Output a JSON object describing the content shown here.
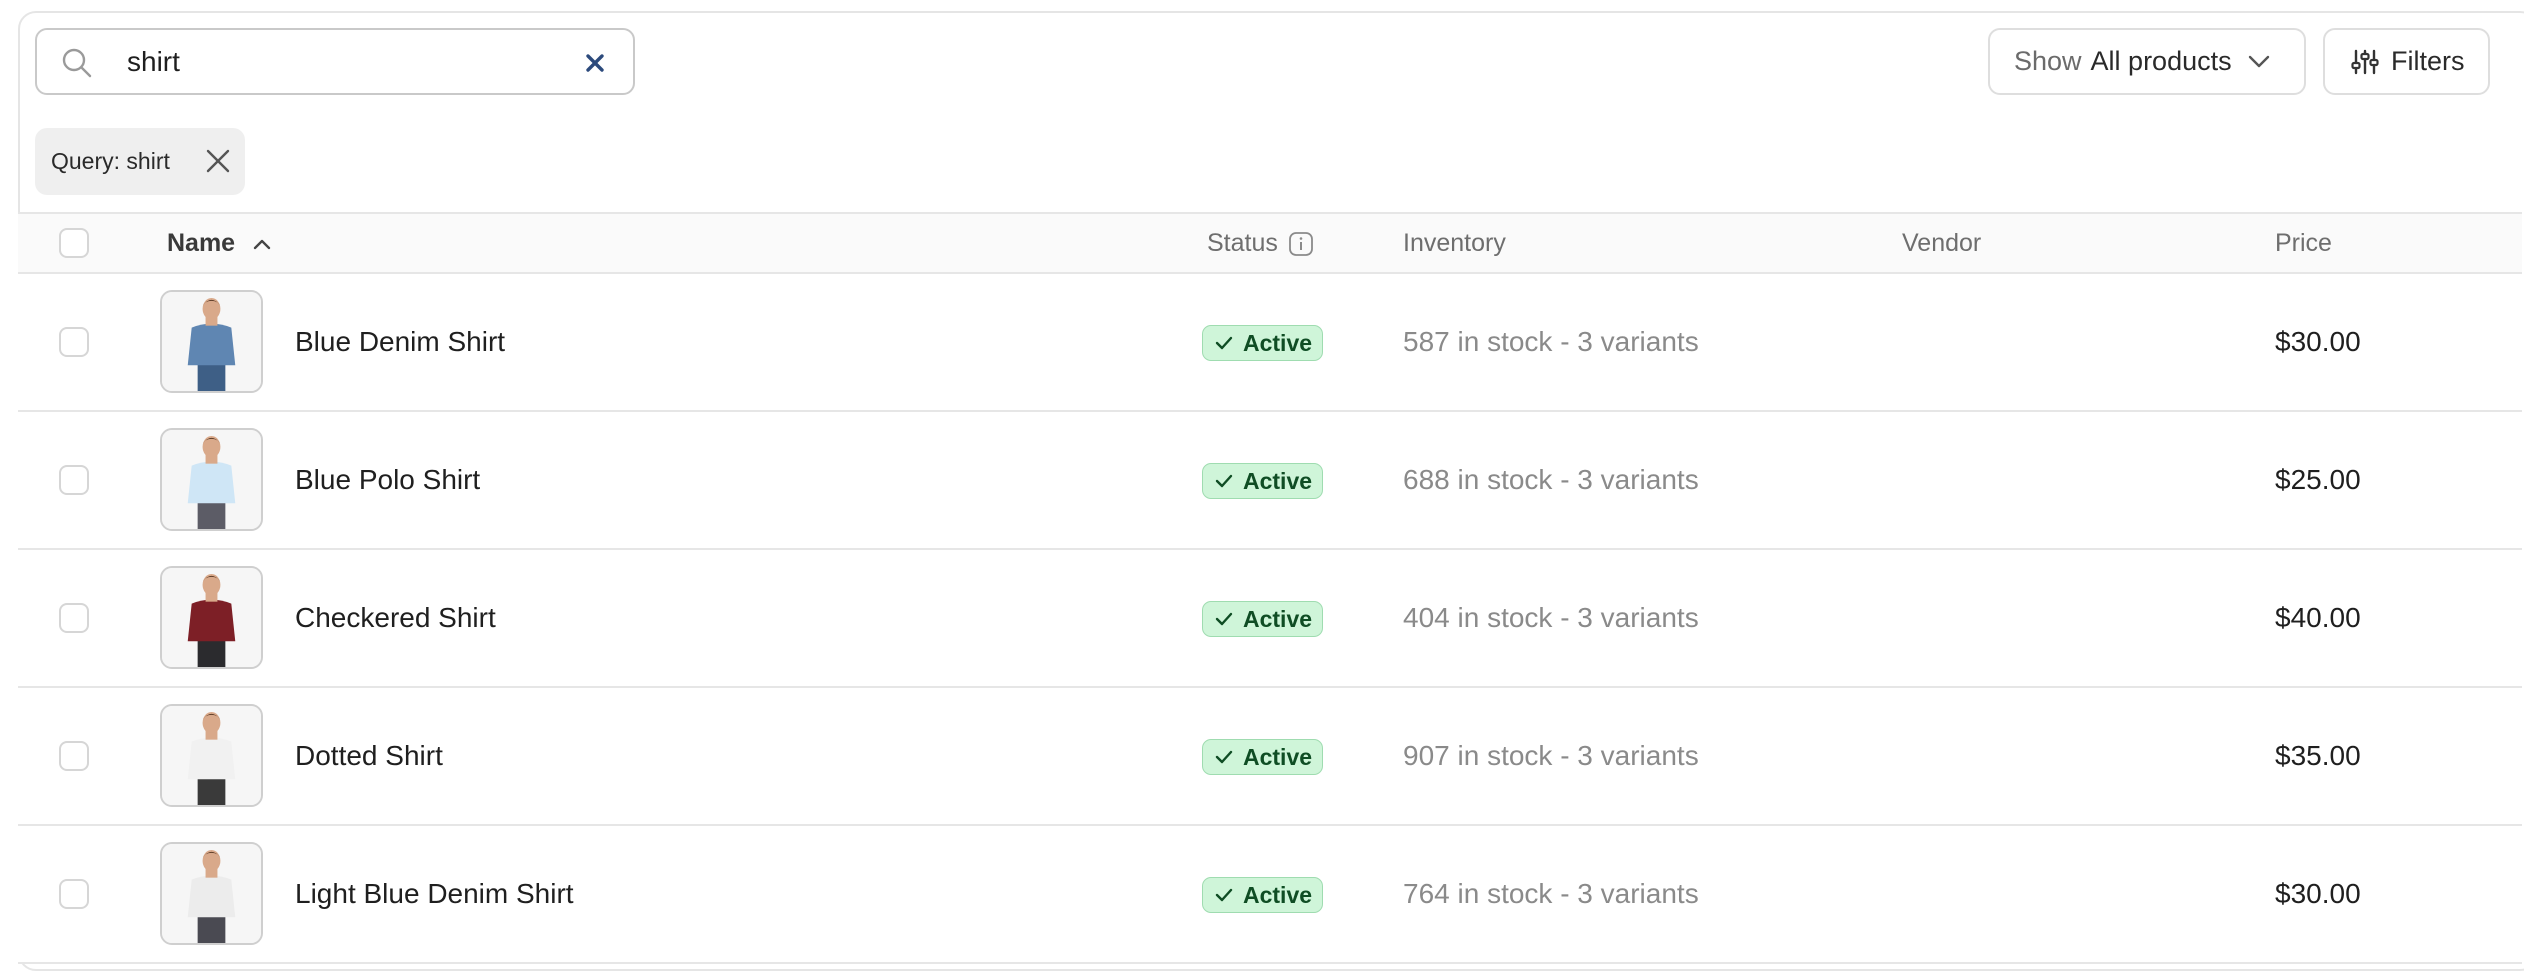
{
  "search": {
    "value": "shirt",
    "placeholder": ""
  },
  "show_button": {
    "prefix": "Show",
    "value": "All products"
  },
  "filters_button": {
    "label": "Filters"
  },
  "active_filter_chip": {
    "label": "Query: shirt"
  },
  "columns": {
    "name": "Name",
    "status": "Status",
    "inventory": "Inventory",
    "vendor": "Vendor",
    "price": "Price"
  },
  "products": [
    {
      "name": "Blue Denim Shirt",
      "status": "Active",
      "inventory": "587 in stock - 3 variants",
      "vendor": "",
      "price": "$30.00",
      "shirt_color": "#5f86b2",
      "pants_color": "#3e5f86"
    },
    {
      "name": "Blue Polo Shirt",
      "status": "Active",
      "inventory": "688 in stock - 3 variants",
      "vendor": "",
      "price": "$25.00",
      "shirt_color": "#cfe6f6",
      "pants_color": "#5c5c66"
    },
    {
      "name": "Checkered Shirt",
      "status": "Active",
      "inventory": "404 in stock - 3 variants",
      "vendor": "",
      "price": "$40.00",
      "shirt_color": "#7d1f26",
      "pants_color": "#2b2b2e"
    },
    {
      "name": "Dotted Shirt",
      "status": "Active",
      "inventory": "907 in stock - 3 variants",
      "vendor": "",
      "price": "$35.00",
      "shirt_color": "#f1f1f1",
      "pants_color": "#3a3a3a"
    },
    {
      "name": "Light Blue Denim Shirt",
      "status": "Active",
      "inventory": "764 in stock - 3 variants",
      "vendor": "",
      "price": "$30.00",
      "shirt_color": "#ececec",
      "pants_color": "#4a4a52"
    }
  ],
  "colors": {
    "badge_bg": "#cff5d9",
    "badge_text": "#0f4d24",
    "clear_icon": "#2c4a7c"
  },
  "icons": {
    "search": "magnifier-icon",
    "clear": "x-icon",
    "chevron": "chevron-down-icon",
    "filters": "sliders-icon",
    "chip_remove": "close-icon",
    "sort": "chevron-up-icon",
    "info": "info-icon",
    "check": "check-icon"
  }
}
